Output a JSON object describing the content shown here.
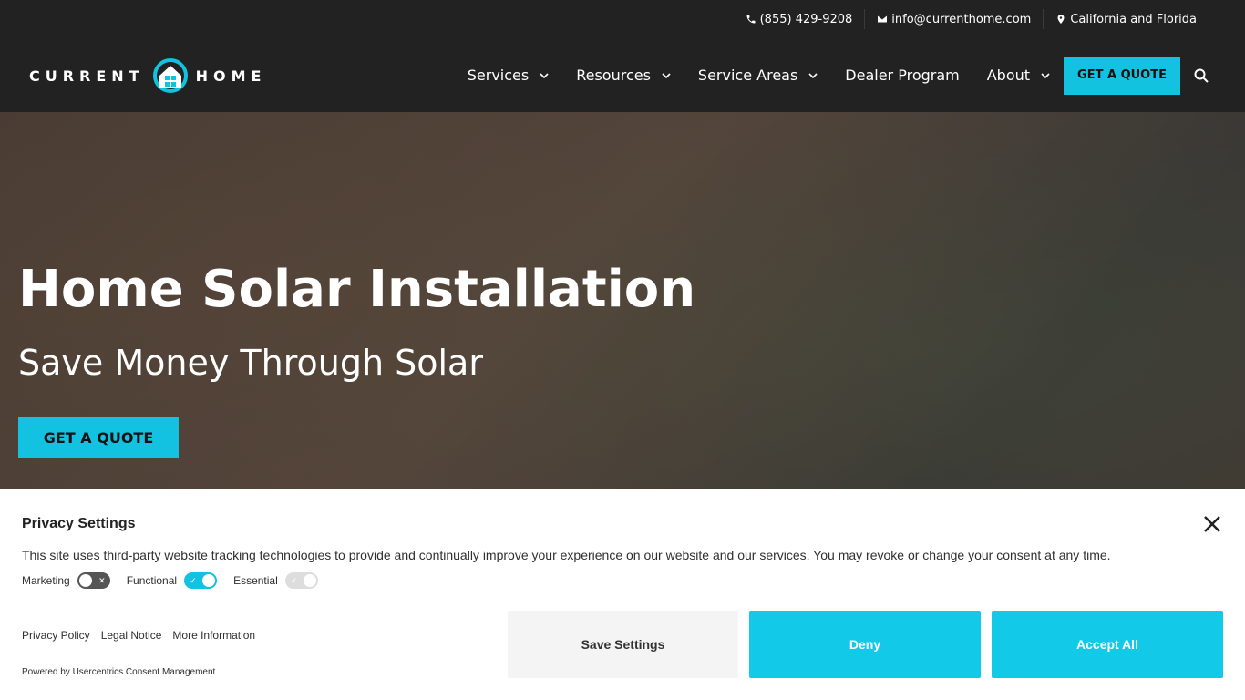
{
  "topbar": {
    "phone": "(855) 429-9208",
    "email": "info@currenthome.com",
    "location": "California and Florida"
  },
  "header": {
    "logo_left": "CURRENT",
    "logo_right": "HOME",
    "nav": [
      {
        "label": "Services",
        "dropdown": true
      },
      {
        "label": "Resources",
        "dropdown": true
      },
      {
        "label": "Service Areas",
        "dropdown": true
      },
      {
        "label": "Dealer Program",
        "dropdown": false
      },
      {
        "label": "About",
        "dropdown": true
      }
    ],
    "quote_button": "GET A QUOTE"
  },
  "hero": {
    "title": "Home Solar Installation",
    "subtitle": "Save Money Through Solar",
    "cta": "GET A QUOTE"
  },
  "privacy": {
    "title": "Privacy Settings",
    "description": "This site uses third-party website tracking technologies to provide and continually improve your experience on our website and our services. You may revoke or change your consent at any time.",
    "toggles": [
      {
        "label": "Marketing",
        "state": "off"
      },
      {
        "label": "Functional",
        "state": "on"
      },
      {
        "label": "Essential",
        "state": "disabled"
      }
    ],
    "links": [
      "Privacy Policy",
      "Legal Notice",
      "More Information"
    ],
    "powered_by": "Powered by Usercentrics Consent Management",
    "buttons": {
      "save": "Save Settings",
      "deny": "Deny",
      "accept": "Accept All"
    }
  },
  "colors": {
    "accent": "#13c1e0",
    "header_bg": "#222222"
  }
}
